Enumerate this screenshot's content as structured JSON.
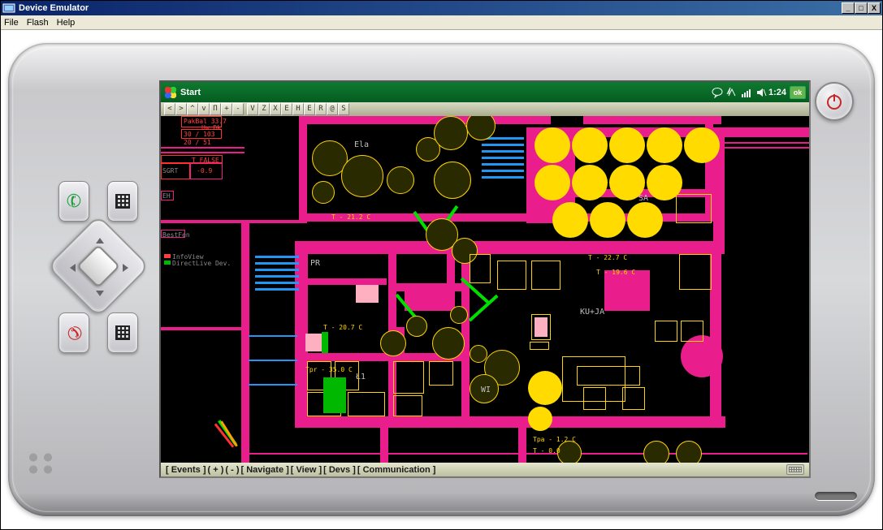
{
  "window": {
    "title": "Device Emulator",
    "menu": {
      "file": "File",
      "flash": "Flash",
      "help": "Help"
    }
  },
  "wm": {
    "start": "Start",
    "time": "1:24",
    "ok": "ok"
  },
  "toolbar": {
    "b0": "<",
    "b1": ">",
    "b2": "^",
    "b3": "v",
    "b4": "П",
    "b5": "+",
    "b6": "-",
    "b7": "V",
    "b8": "Z",
    "b9": "X",
    "b10": "E",
    "b11": "H",
    "b12": "E",
    "b13": "R",
    "b14": "@",
    "b15": "S"
  },
  "rooms": {
    "ela": "Ela",
    "pr": "PR",
    "l1": "Ł1",
    "wi": "WI",
    "sa": "SA",
    "kuja": "KU+JA"
  },
  "temps": {
    "ela": "T - 21.2 C",
    "pr": "T - 20.7 C",
    "l1": "Tpr - 35.0 C",
    "kuja1": "T - 22.7 C",
    "kuja2": "T - 19.6 C",
    "tpa": "Tpa - 1.2 C",
    "tt": "T - 0.0"
  },
  "sidepanel": {
    "p1": "PakBal 33.7",
    "p2": "Uw Dk",
    "t30": "30 / 103",
    "t20": "20 / 51",
    "sgrt": "SGRT",
    "sgrt_v": "-0.9",
    "tfalse": "T FALSE",
    "eh": "EH",
    "bu": "BestFen",
    "leg1": "InfoView",
    "leg2": "DirectLive Dev."
  },
  "bottom": {
    "events": "[ Events ]",
    "plus": "(  +  )",
    "minus": "(  -  )",
    "navigate": "[ Navigate ]",
    "view": "[ View ]",
    "devs": "[ Devs ]",
    "comm": "[ Communication ]"
  }
}
